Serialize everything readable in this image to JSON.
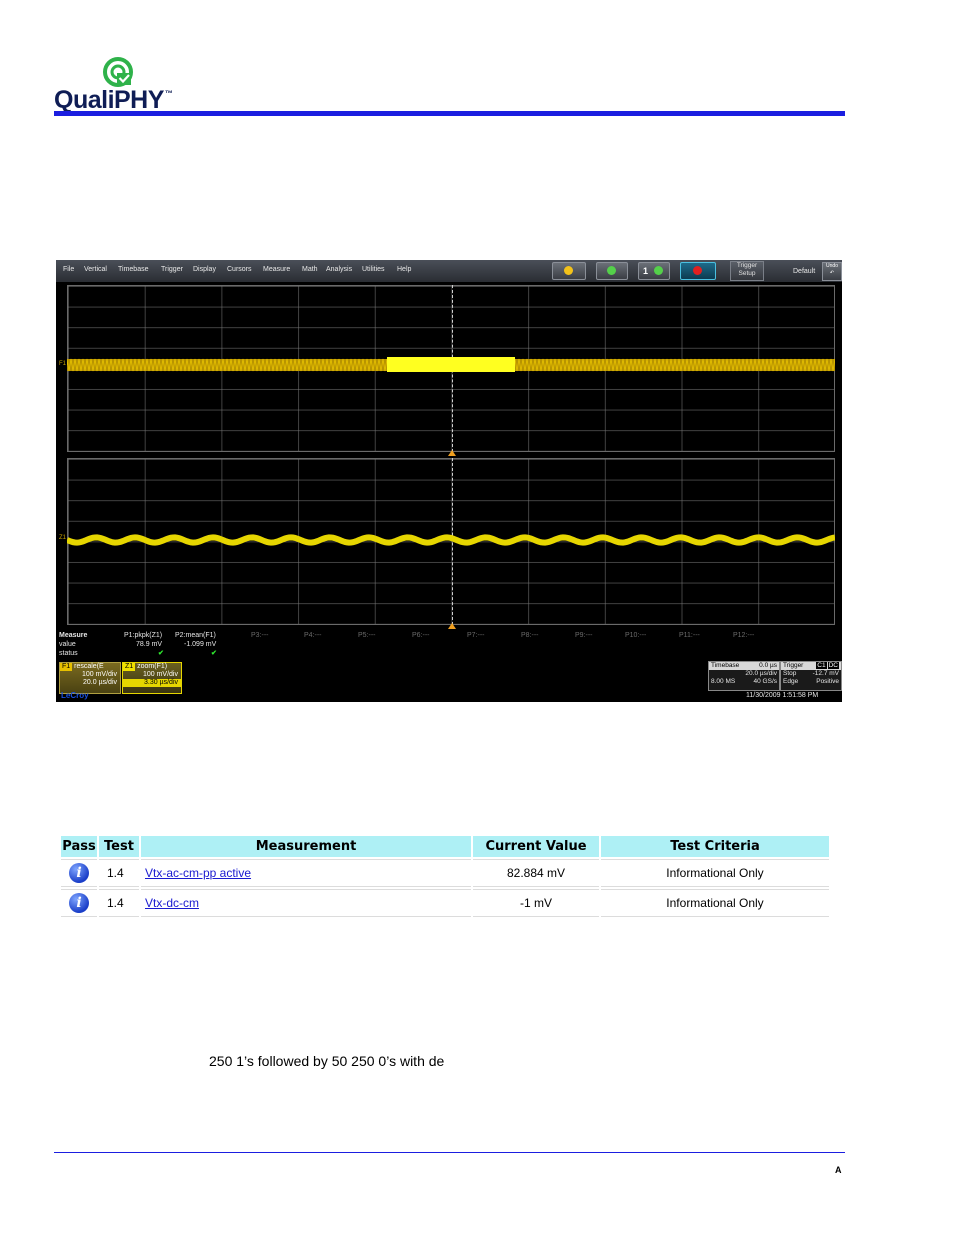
{
  "header": {
    "logo_text": "QualiPHY",
    "logo_tm": "™",
    "accent": "#1b1ee0",
    "logo_color": "#0f1d55"
  },
  "scope": {
    "menu": [
      "File",
      "Vertical",
      "Timebase",
      "Trigger",
      "Display",
      "Cursors",
      "Measure",
      "Math",
      "Analysis",
      "Utilities",
      "Help"
    ],
    "trigger_setup": [
      "Trigger",
      "Setup"
    ],
    "toolbar_number": "1",
    "default_label": "Default",
    "undo_label": [
      "Undo",
      "↶"
    ],
    "trace_top_label": "F1",
    "trace_bottom_label": "Z1",
    "measure": {
      "row_labels": [
        "Measure",
        "value",
        "status"
      ],
      "p1_name": "P1:pkpk(Z1)",
      "p1_value": "78.9 mV",
      "p1_status": "✔",
      "p2_name": "P2:mean(F1)",
      "p2_value": "-1.099 mV",
      "p2_status": "✔",
      "inactive": [
        "P3:---",
        "P4:---",
        "P5:---",
        "P6:---",
        "P7:---",
        "P8:---",
        "P9:---",
        "P10:---",
        "P11:---",
        "P12:---"
      ]
    },
    "f1": {
      "badge": "F1",
      "name": "rescale(E",
      "vdiv": "100 mV/div",
      "tdiv": "20.0 µs/div"
    },
    "z1": {
      "badge": "Z1",
      "name": "zoom(F1)",
      "vdiv": "100 mV/div",
      "tdiv": "3.30 µs/div"
    },
    "brand": "LeCroy",
    "timebase": {
      "label": "Timebase",
      "delay": "0.0 µs",
      "tdiv": "20.0 µs/div",
      "samples": "8.00 MS",
      "rate": "40 GS/s"
    },
    "trigger": {
      "label": "Trigger",
      "chan": "C1",
      "coupling": "DC",
      "mode": "Stop",
      "level": "-12.7 mV",
      "type": "Edge",
      "slope": "Positive"
    },
    "date": "11/30/2009 1:51:58 PM",
    "trace_color": "#e6d600",
    "highlight_color": "#ffff20"
  },
  "results": {
    "headers": [
      "Pass",
      "Test",
      "Measurement",
      "Current Value",
      "Test Criteria"
    ],
    "rows": [
      {
        "icon": "i",
        "test": "1.4",
        "measurement": "Vtx-ac-cm-pp active",
        "value": "82.884 mV",
        "criteria": "Informational Only"
      },
      {
        "icon": "i",
        "test": "1.4",
        "measurement": "Vtx-dc-cm",
        "value": "-1 mV",
        "criteria": "Informational Only"
      }
    ]
  },
  "body_text": "250 1’s followed by 50 250 0’s with de",
  "footer": {
    "letter": "A"
  }
}
